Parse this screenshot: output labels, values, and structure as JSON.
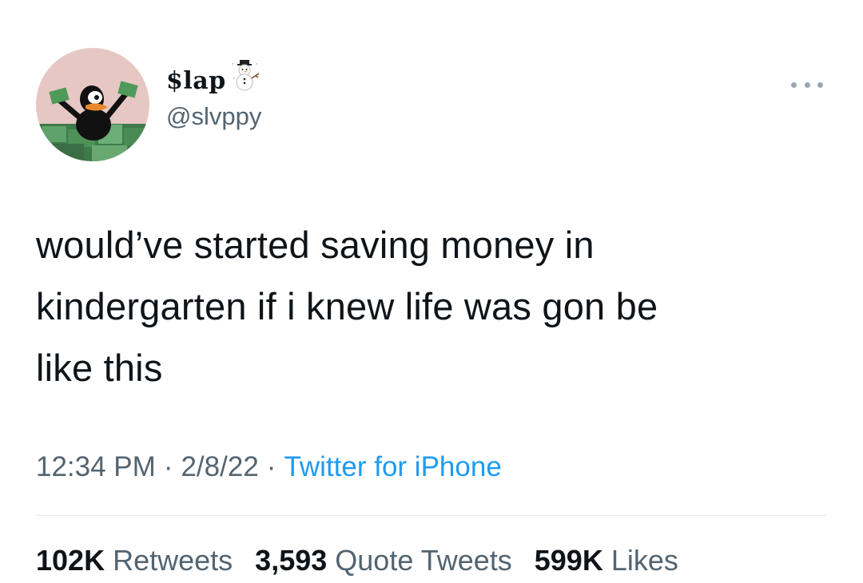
{
  "author": {
    "display_name": "$lap",
    "name_emoji": "snowman-icon",
    "handle": "@slvppy",
    "avatar": "daffy-duck-with-money-avatar"
  },
  "menu": {
    "icon": "more-horizontal-icon"
  },
  "tweet": {
    "text_lines": [
      "would’ve started saving money in",
      "kindergarten if i knew life was gon be",
      "like this"
    ]
  },
  "meta": {
    "time": "12:34 PM",
    "date": "2/8/22",
    "separator": "·",
    "source": "Twitter for iPhone"
  },
  "stats": {
    "retweets_count": "102K",
    "retweets_label": "Retweets",
    "quotes_count": "3,593",
    "quotes_label": "Quote Tweets",
    "likes_count": "599K",
    "likes_label": "Likes"
  },
  "colors": {
    "text_primary": "#0f1419",
    "text_secondary": "#536471",
    "link": "#1d9bf0",
    "divider": "#e3e7ea"
  }
}
